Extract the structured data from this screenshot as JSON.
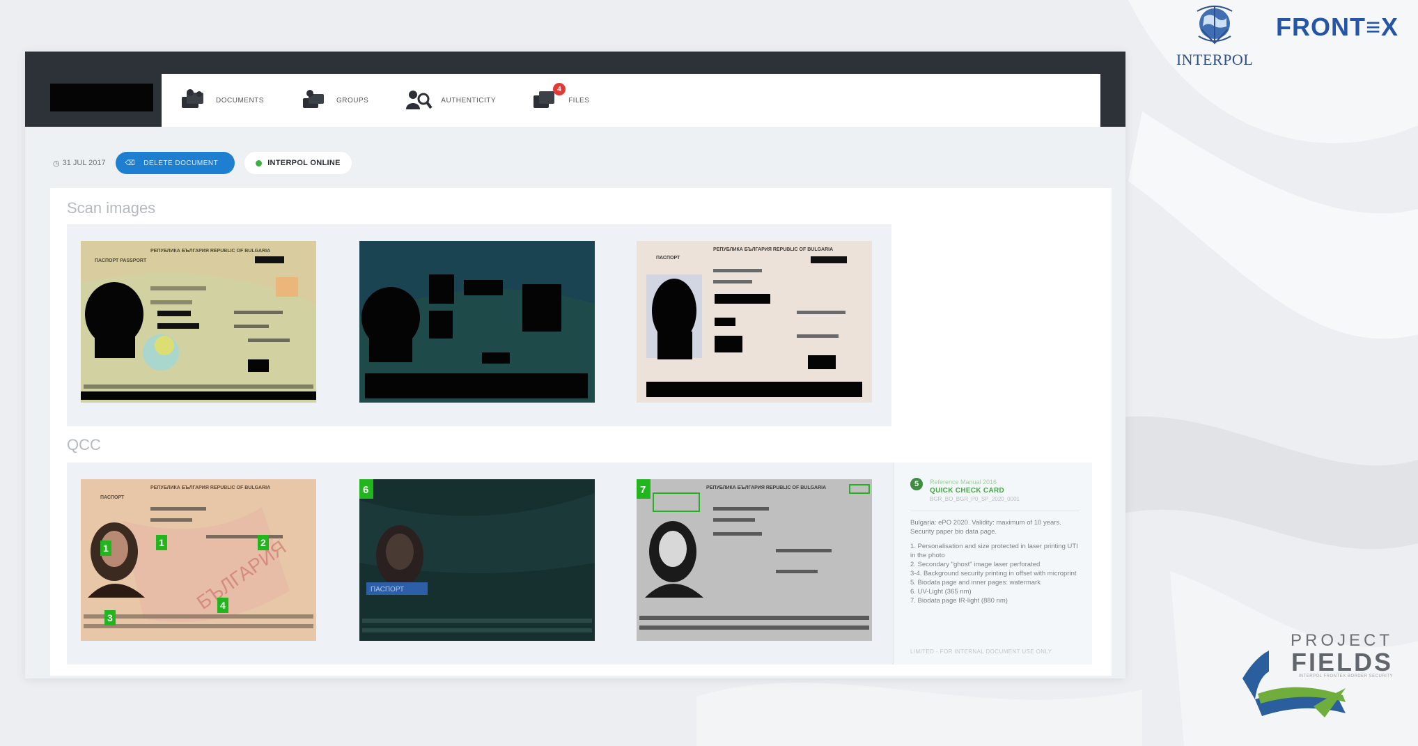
{
  "app": {
    "nav": [
      {
        "label": "DOCUMENTS",
        "icon": "documents-icon"
      },
      {
        "label": "GROUPS",
        "icon": "groups-icon"
      },
      {
        "label": "AUTHENTICITY",
        "icon": "authenticity-icon"
      },
      {
        "label": "FILES",
        "icon": "files-icon",
        "badge": "4"
      }
    ],
    "toolbar": {
      "date": "31 JUL 2017",
      "delete_label": "DELETE DOCUMENT",
      "status_label": "INTERPOL ONLINE"
    }
  },
  "scan": {
    "title": "Scan images",
    "doc_header": "РЕПУБЛИКА БЪЛГАРИЯ REPUBLIC OF BULGARIA",
    "doc_type": "ПАСПОРТ PASSPORT"
  },
  "qcc": {
    "title": "QCC",
    "markers": [
      "1",
      "1",
      "2",
      "3",
      "4",
      "6",
      "7"
    ],
    "uv_label": "ПАСПОРТ",
    "card": {
      "icon_label": "5",
      "ref": "Reference Manual 2016",
      "title": "QUICK CHECK CARD",
      "code": "BGR_BO_BGR_P0_SP_2020_0001",
      "description": "Bulgaria: ePO 2020. Validity: maximum of 10 years. Security paper bio data page.",
      "items": [
        "1. Personalisation and size protected in laser printing UTI in the photo",
        "2. Secondary \"ghost\" image laser perforated",
        "3-4. Background security printing in offset with microprint",
        "5. Biodata page and inner pages: watermark",
        "6. UV-Light (365 nm)",
        "7. Biodata page IR-light (880 nm)"
      ],
      "footer": "LIMITED - FOR INTERNAL DOCUMENT USE ONLY"
    }
  },
  "logos": {
    "interpol": "INTERPOL",
    "frontex": "FRONT≡X",
    "project": "PROJECT",
    "fields": "FIELDS",
    "fields_sub": "INTERPOL FRONTEX BORDER SECURITY"
  },
  "colors": {
    "topbar": "#2d3138",
    "accent_blue": "#1e7fd0",
    "online_green": "#3cb043",
    "qcc_green": "#46a348",
    "marker_green": "#22b61e"
  }
}
